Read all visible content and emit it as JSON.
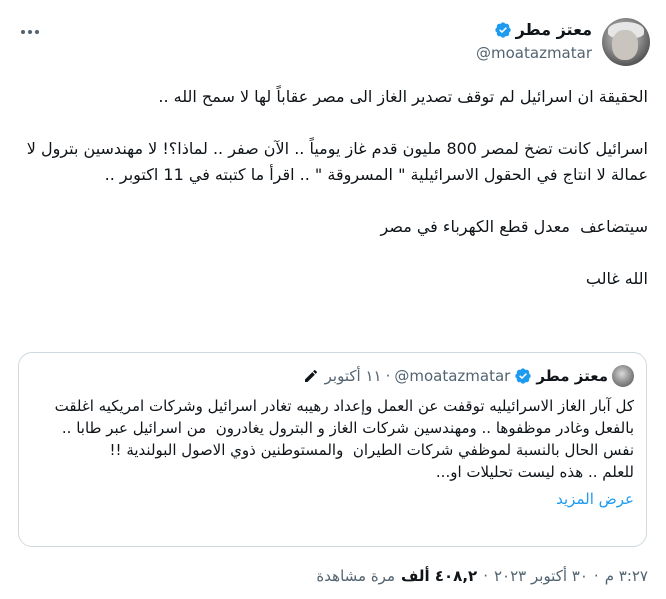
{
  "tweet": {
    "author_name": "معتز مطر",
    "author_handle": "@moatazmatar",
    "text": "الحقيقة ان اسرائيل لم توقف تصدير الغاز الى مصر عقاباً لها لا سمح الله ..\n\nاسرائيل كانت تضخ لمصر 800 مليون قدم غاز يومياً .. الآن صفر .. لماذا؟! لا مهندسين بترول لا عمالة لا انتاج في الحقول الاسرائيلية \" المسروقة \" .. اقرأ ما كتبته في 11 اكتوبر ..\n\nسيتضاعف  معدل قطع الكهرباء في مصر\n\nالله غالب",
    "time": "٣:٢٧ م",
    "separator": "·",
    "date": "٣٠ أكتوبر ٢٠٢٣",
    "views_count": "٤٠٨,٢ ألف",
    "views_label": "مرة مشاهدة"
  },
  "quoted": {
    "author_name": "معتز مطر",
    "author_handle": "@moatazmatar",
    "separator": "·",
    "date": "١١ أكتوبر",
    "text": "كل آبار الغاز الاسرائيليه توقفت عن العمل وإعداد رهيبه تغادر اسرائيل وشركات امريكيه اغلقت بالفعل وغادر موظفوها .. ومهندسين شركات الغاز و البترول يغادرون  من اسرائيل عبر طابا .. نفس الحال بالنسبة لموظفي شركات الطيران  والمستوطنين ذوي الاصول البولندية !!\nللعلم .. هذه ليست تحليلات او...",
    "show_more": "عرض المزيد"
  },
  "icons": {
    "more": "more-horizontal-icon",
    "verified": "verified-badge-icon",
    "edited": "pencil-icon"
  },
  "colors": {
    "accent": "#1d9bf0",
    "secondary_text": "#536471",
    "border": "#cfd9de"
  }
}
